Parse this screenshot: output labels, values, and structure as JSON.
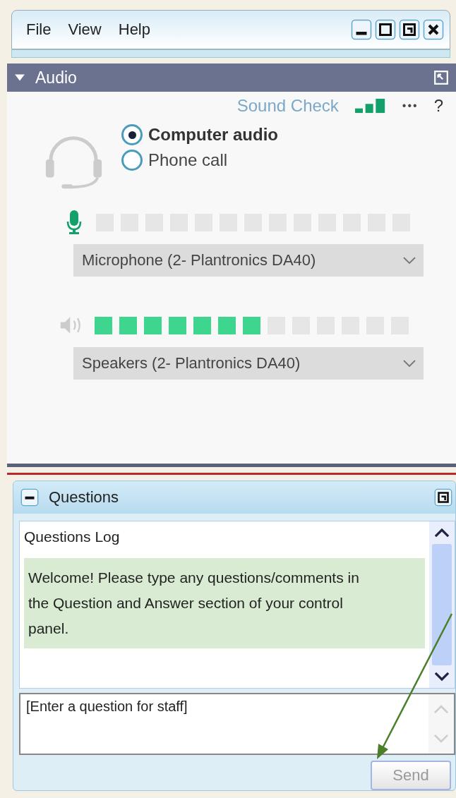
{
  "menu": [
    "File",
    "View",
    "Help"
  ],
  "audio": {
    "title": "Audio",
    "expanded": true,
    "sound_check": "Sound Check",
    "more": "•••",
    "help": "?",
    "options": [
      {
        "label": "Computer audio",
        "selected": true
      },
      {
        "label": "Phone call",
        "selected": false
      }
    ],
    "devices": [
      {
        "kind": "microphone",
        "value": "Microphone (2- Plantronics DA40)"
      },
      {
        "kind": "speaker",
        "level": 0.54,
        "value": "Speakers (2- Plantronics DA40)"
      }
    ]
  },
  "questions": {
    "title": "Questions",
    "expanded": true,
    "log_title": "Questions Log",
    "message": "Welcome! Please type any questions/comments in the Question and Answer section of your control panel.",
    "placeholder": "[Enter a question for staff]",
    "send": {
      "label": "Send",
      "disabled": true
    }
  }
}
